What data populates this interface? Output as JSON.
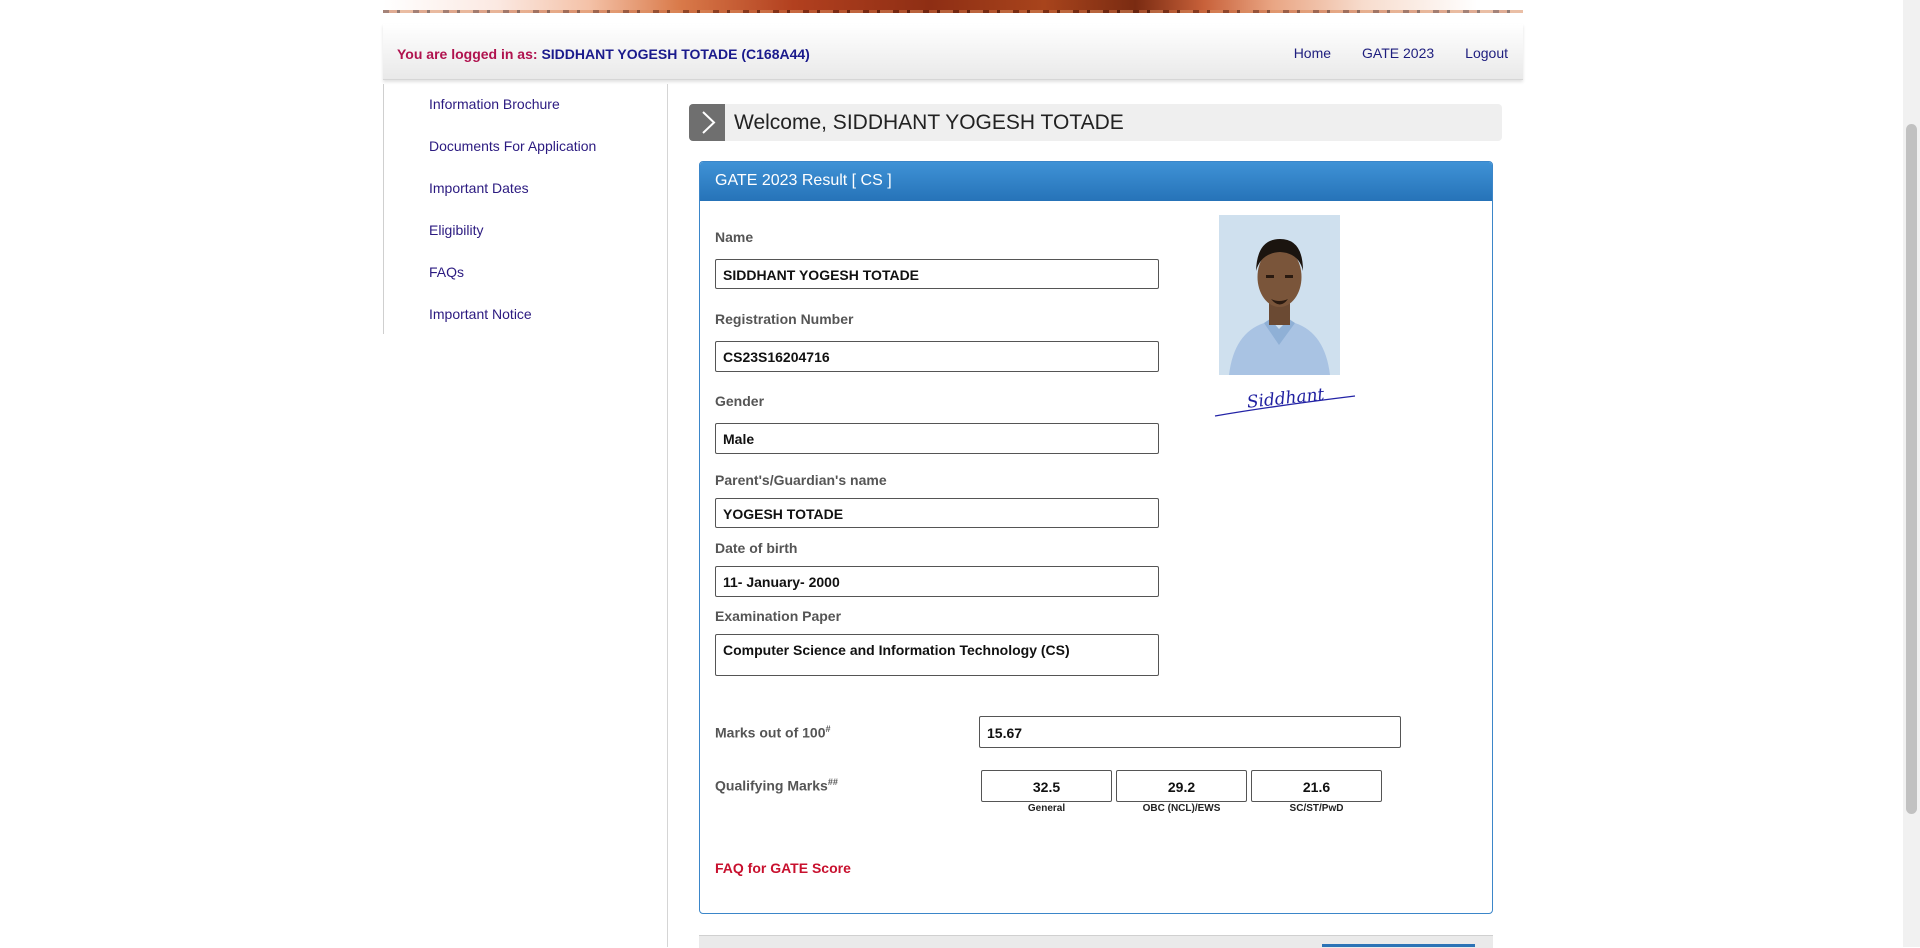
{
  "header": {
    "logged_prefix": "You are logged in as: ",
    "logged_user": "SIDDHANT YOGESH TOTADE (C168A44)",
    "nav": [
      "Home",
      "GATE 2023",
      "Logout"
    ]
  },
  "sidebar": {
    "items": [
      "Information Brochure",
      "Documents For Application",
      "Important Dates",
      "Eligibility",
      "FAQs",
      "Important Notice"
    ]
  },
  "welcome": {
    "text": "Welcome, SIDDHANT YOGESH TOTADE"
  },
  "result": {
    "title": "GATE 2023 Result [ CS ]",
    "fields": {
      "name_label": "Name",
      "name_value": "SIDDHANT YOGESH TOTADE",
      "reg_label": "Registration Number",
      "reg_value": "CS23S16204716",
      "gender_label": "Gender",
      "gender_value": "Male",
      "parent_label": "Parent's/Guardian's name",
      "parent_value": "YOGESH TOTADE",
      "dob_label": "Date of birth",
      "dob_value": "11- January- 2000",
      "paper_label": "Examination Paper",
      "paper_value": "Computer Science and Information Technology (CS)"
    },
    "marks": {
      "label": "Marks out of 100",
      "label_sup": "#",
      "value": "15.67"
    },
    "qualifying": {
      "label": "Qualifying Marks",
      "label_sup": "##",
      "values": [
        "32.5",
        "29.2",
        "21.6"
      ],
      "captions": [
        "General",
        "OBC (NCL)/EWS",
        "SC/ST/PwD"
      ]
    },
    "signature_text": "Siddhant",
    "faq_link": "FAQ for GATE Score"
  },
  "colors": {
    "panel_header": "#2f80c6",
    "logged_prefix": "#b0124e",
    "link": "#2b1a80",
    "faq": "#c8102e"
  }
}
